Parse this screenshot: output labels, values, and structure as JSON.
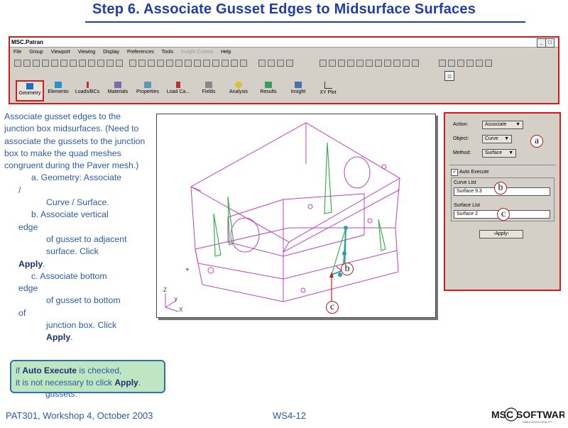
{
  "slide": {
    "title": "Step 6.  Associate Gusset Edges to Midsurface Surfaces"
  },
  "app": {
    "window_title": "MSC.Patran",
    "menu": [
      "File",
      "Group",
      "Viewport",
      "Viewing",
      "Display",
      "Preferences",
      "Tools",
      "Insight Control",
      "Help"
    ],
    "disabled_menu": "Insight Control",
    "app_buttons": [
      "Geometry",
      "Elements",
      "Loads/BCs",
      "Materials",
      "Properties",
      "Load Ca...",
      "Fields",
      "Analysis",
      "Results",
      "Insight",
      "XY Plot"
    ],
    "highlighted_button": "Geometry"
  },
  "instructions": {
    "intro": "Associate gusset edges to the junction box midsurfaces. (Need to associate the gussets to the junction box to make the quad meshes congruent during the Paver mesh.)",
    "line_a1": "a.  Geometry: Associate",
    "line_a1b": "/",
    "line_a2": "Curve / Surface.",
    "line_b1": "b.  Associate vertical",
    "line_b1b": "edge",
    "line_b2": "of gusset to adjacent",
    "line_b3": "surface.  Click",
    "apply1": "Apply",
    "line_c1": "c.  Associate bottom",
    "line_c1b": "edge",
    "line_c2": "of gusset to bottom",
    "line_c2b": "of",
    "line_c3": "junction box.  Click",
    "apply2": "Apply",
    "line_hidden": "gussets."
  },
  "form": {
    "action_label": "Action:",
    "action_value": "Associate",
    "object_label": "Object:",
    "object_value": "Curve",
    "method_label": "Method:",
    "method_value": "Surface",
    "auto_execute_label": "Auto Execute",
    "auto_execute_checked": true,
    "curve_list_label": "Curve List",
    "curve_list_value": "Surface 9.3",
    "surface_list_label": "Surface List",
    "surface_list_value": "Surface 2",
    "apply_label": "-Apply-"
  },
  "callouts": {
    "a": "a",
    "b": "b",
    "c": "c"
  },
  "viewport": {
    "axis_z": "Z",
    "axis_y": "Y",
    "axis_x": "X"
  },
  "note": {
    "line1_pre": "if ",
    "line1_bold": "Auto Execute",
    "line1_post": " is checked,",
    "line2_pre": "it is not necessary to click ",
    "line2_bold": "Apply",
    "line2_post": "."
  },
  "footer": {
    "left": "PAT301, Workshop 4, October 2003",
    "center": "WS4-12",
    "logo_text": "MSC SOFTWARE",
    "logo_tagline": "SIMULATING REALITY"
  },
  "colors": {
    "title_blue": "#1f3ea8",
    "text_blue": "#2b5aa8",
    "highlight_red": "#d21b1b",
    "model_magenta": "#c040c0",
    "gusset_green": "#3cb050",
    "note_green": "#bde6c1"
  }
}
